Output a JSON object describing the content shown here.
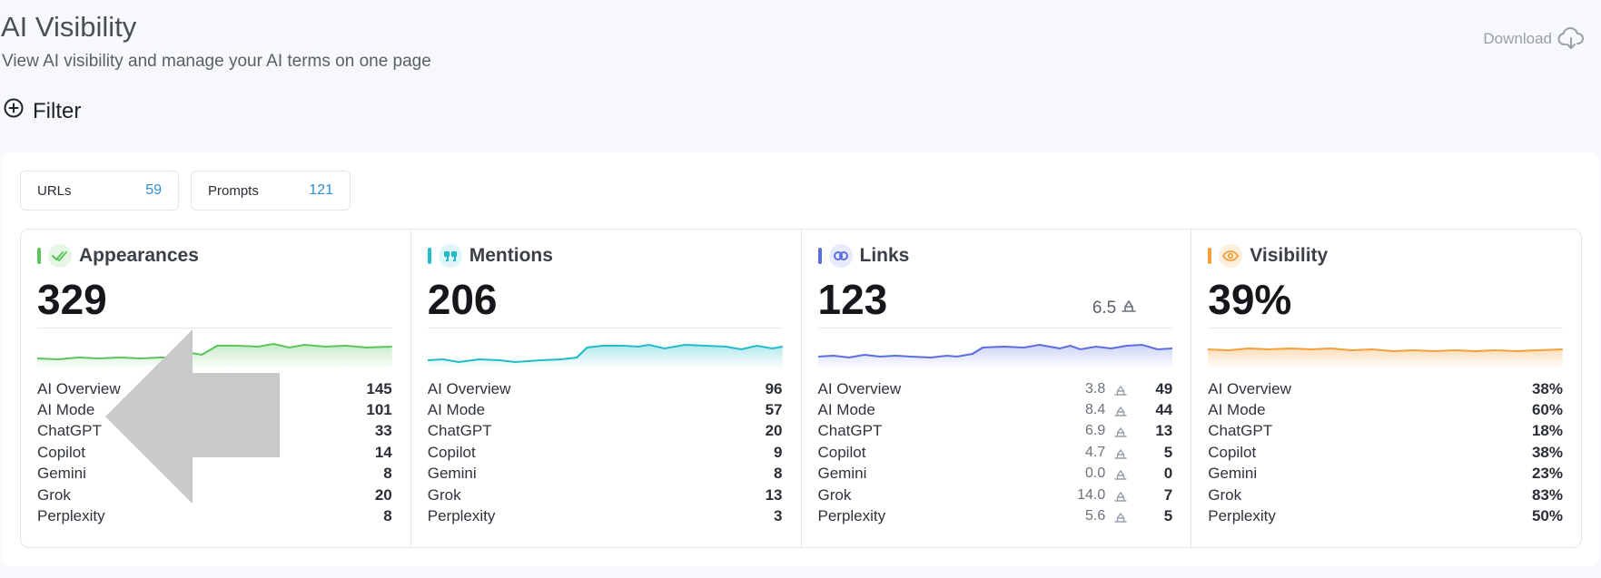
{
  "header": {
    "title": "AI Visibility",
    "subtitle": "View AI visibility and manage your AI terms on one page",
    "download_label": "Download"
  },
  "filter": {
    "label": "Filter"
  },
  "chips": {
    "urls": {
      "label": "URLs",
      "count": "59"
    },
    "prompts": {
      "label": "Prompts",
      "count": "121"
    }
  },
  "cards": {
    "appearances": {
      "title": "Appearances",
      "value": "329",
      "color": "#5cc45a",
      "rows": [
        {
          "label": "AI Overview",
          "value": "145"
        },
        {
          "label": "AI Mode",
          "value": "101"
        },
        {
          "label": "ChatGPT",
          "value": "33"
        },
        {
          "label": "Copilot",
          "value": "14"
        },
        {
          "label": "Gemini",
          "value": "8"
        },
        {
          "label": "Grok",
          "value": "20"
        },
        {
          "label": "Perplexity",
          "value": "8"
        }
      ]
    },
    "mentions": {
      "title": "Mentions",
      "value": "206",
      "color": "#22bcc9",
      "rows": [
        {
          "label": "AI Overview",
          "value": "96"
        },
        {
          "label": "AI Mode",
          "value": "57"
        },
        {
          "label": "ChatGPT",
          "value": "20"
        },
        {
          "label": "Copilot",
          "value": "9"
        },
        {
          "label": "Gemini",
          "value": "8"
        },
        {
          "label": "Grok",
          "value": "13"
        },
        {
          "label": "Perplexity",
          "value": "3"
        }
      ]
    },
    "links": {
      "title": "Links",
      "value": "123",
      "delta": "6.5",
      "color": "#5b6ee0",
      "rows": [
        {
          "label": "AI Overview",
          "sub": "3.8",
          "value": "49"
        },
        {
          "label": "AI Mode",
          "sub": "8.4",
          "value": "44"
        },
        {
          "label": "ChatGPT",
          "sub": "6.9",
          "value": "13"
        },
        {
          "label": "Copilot",
          "sub": "4.7",
          "value": "5"
        },
        {
          "label": "Gemini",
          "sub": "0.0",
          "value": "0"
        },
        {
          "label": "Grok",
          "sub": "14.0",
          "value": "7"
        },
        {
          "label": "Perplexity",
          "sub": "5.6",
          "value": "5"
        }
      ]
    },
    "visibility": {
      "title": "Visibility",
      "value": "39%",
      "color": "#f5a13a",
      "rows": [
        {
          "label": "AI Overview",
          "value": "38%"
        },
        {
          "label": "AI Mode",
          "value": "60%"
        },
        {
          "label": "ChatGPT",
          "value": "18%"
        },
        {
          "label": "Copilot",
          "value": "38%"
        },
        {
          "label": "Gemini",
          "value": "23%"
        },
        {
          "label": "Grok",
          "value": "83%"
        },
        {
          "label": "Perplexity",
          "value": "50%"
        }
      ]
    }
  }
}
